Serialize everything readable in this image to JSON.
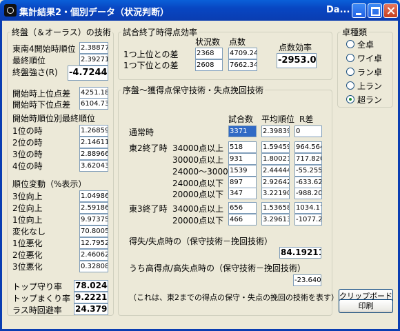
{
  "window": {
    "title": "集計結果2・個別データ（状況判断）",
    "title_suffix": "Da..."
  },
  "left": {
    "endgame": {
      "legend": "終盤（＆オーラス）の技術",
      "rows": [
        {
          "label": "東南4開始時順位",
          "value": "2.38877"
        },
        {
          "label": "最終順位",
          "value": "2.39271"
        }
      ],
      "strength_label": "終盤強さ(R)",
      "strength_value": "-4.7244"
    },
    "start_diff": [
      {
        "label": "開始時上位点差",
        "value": "4251.18"
      },
      {
        "label": "開始時下位点差",
        "value": "6104.73"
      }
    ],
    "final_rank_title": "開始時順位別最終順位",
    "final_rank": [
      {
        "label": "1位の時",
        "value": "1.26859"
      },
      {
        "label": "2位の時",
        "value": "2.14611"
      },
      {
        "label": "3位の時",
        "value": "2.88966"
      },
      {
        "label": "4位の時",
        "value": "3.62043"
      }
    ],
    "rank_change_title": "順位変動（%表示）",
    "rank_change": [
      {
        "label": "3位向上",
        "value": "1.04986"
      },
      {
        "label": "2位向上",
        "value": "2.59186"
      },
      {
        "label": "1位向上",
        "value": "9.97375"
      },
      {
        "label": "変化なし",
        "value": "70.8005"
      },
      {
        "label": "1位悪化",
        "value": "12.7952"
      },
      {
        "label": "2位悪化",
        "value": "2.46062"
      },
      {
        "label": "3位悪化",
        "value": "0.32808"
      }
    ],
    "rates": [
      {
        "label": "トップ守り率",
        "value": "78.0244"
      },
      {
        "label": "トップまくり率",
        "value": "9.22217"
      },
      {
        "label": "ラス時回避率",
        "value": "24.3795"
      }
    ]
  },
  "efficiency": {
    "legend": "試合終了時得点効率",
    "col_count": "状況数",
    "col_points": "点数",
    "col_eff": "点数効率",
    "rows": [
      {
        "label": "1つ上位との差",
        "count": "2368",
        "points": "4709.24"
      },
      {
        "label": "1つ下位との差",
        "count": "2608",
        "points": "7662.34"
      }
    ],
    "eff_value": "-2953.0"
  },
  "midgame": {
    "legend": "序盤～獲得点保守技術・失点挽回技術",
    "col_games": "試合数",
    "col_avg": "平均順位",
    "col_r": "R差",
    "normal": {
      "label": "通常時",
      "games": "3371",
      "avg": "2.39839",
      "r": "0"
    },
    "east2_label": "東2終了時",
    "east2": [
      {
        "label": "34000点以上",
        "games": "518",
        "avg": "1.59459",
        "r": "964.564"
      },
      {
        "label": "30000点以上",
        "games": "931",
        "avg": "1.80021",
        "r": "717.820"
      },
      {
        "label": "24000～30000",
        "games": "1539",
        "avg": "2.44444",
        "r": "-55.255"
      },
      {
        "label": "24000点以下",
        "games": "897",
        "avg": "2.92642",
        "r": "-633.62"
      },
      {
        "label": "20000点以下",
        "games": "347",
        "avg": "3.22190",
        "r": "-988.20"
      }
    ],
    "east3_label": "東3終了時",
    "east3": [
      {
        "label": "34000点以上",
        "games": "656",
        "avg": "1.53658",
        "r": "1034.17"
      },
      {
        "label": "20000点以下",
        "games": "466",
        "avg": "3.29613",
        "r": "-1077.2"
      }
    ],
    "gain_loss_label": "得失/失点時の（保守技術－挽回技術）",
    "gain_loss_value": "84.19211",
    "high_label": "うち高得点/高失点時の（保守技術－挽回技術）",
    "high_value": "-23.640",
    "note": "（これは、東2までの得点の保守・失点の挽回の技術を表す）"
  },
  "table_type": {
    "legend": "卓種類",
    "options": [
      "全卓",
      "ワイ卓",
      "ラン卓",
      "上ラン",
      "超ラン"
    ],
    "selected": "超ラン"
  },
  "buttons": {
    "clipboard": "クリップボード",
    "print": "印刷"
  }
}
